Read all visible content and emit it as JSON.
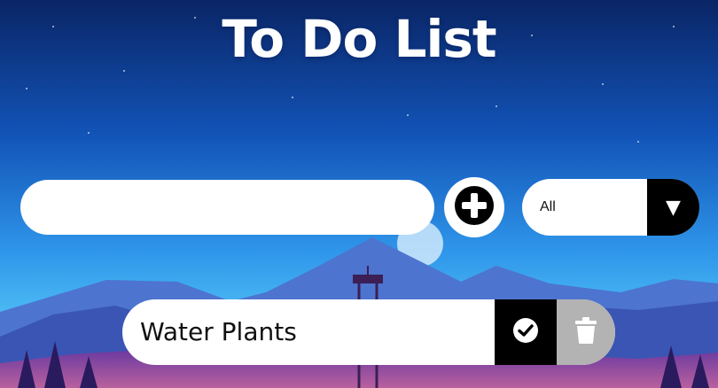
{
  "app": {
    "title": "To Do List"
  },
  "form": {
    "input_value": "",
    "input_placeholder": ""
  },
  "filter": {
    "selected": "All",
    "arrow_glyph": "▼"
  },
  "todos": [
    {
      "text": "Water Plants"
    }
  ],
  "icons": {
    "add": "plus-circle-icon",
    "filter_arrow": "caret-down-icon",
    "complete": "check-circle-icon",
    "delete": "trash-icon"
  },
  "colors": {
    "sky_top": "#0a2a66",
    "sky_bottom": "#33b0f5",
    "mountain": "#4a6fc9",
    "foreground": "#5b2b86",
    "button_dark": "#000000",
    "trash_bg": "#b3b3b3"
  }
}
